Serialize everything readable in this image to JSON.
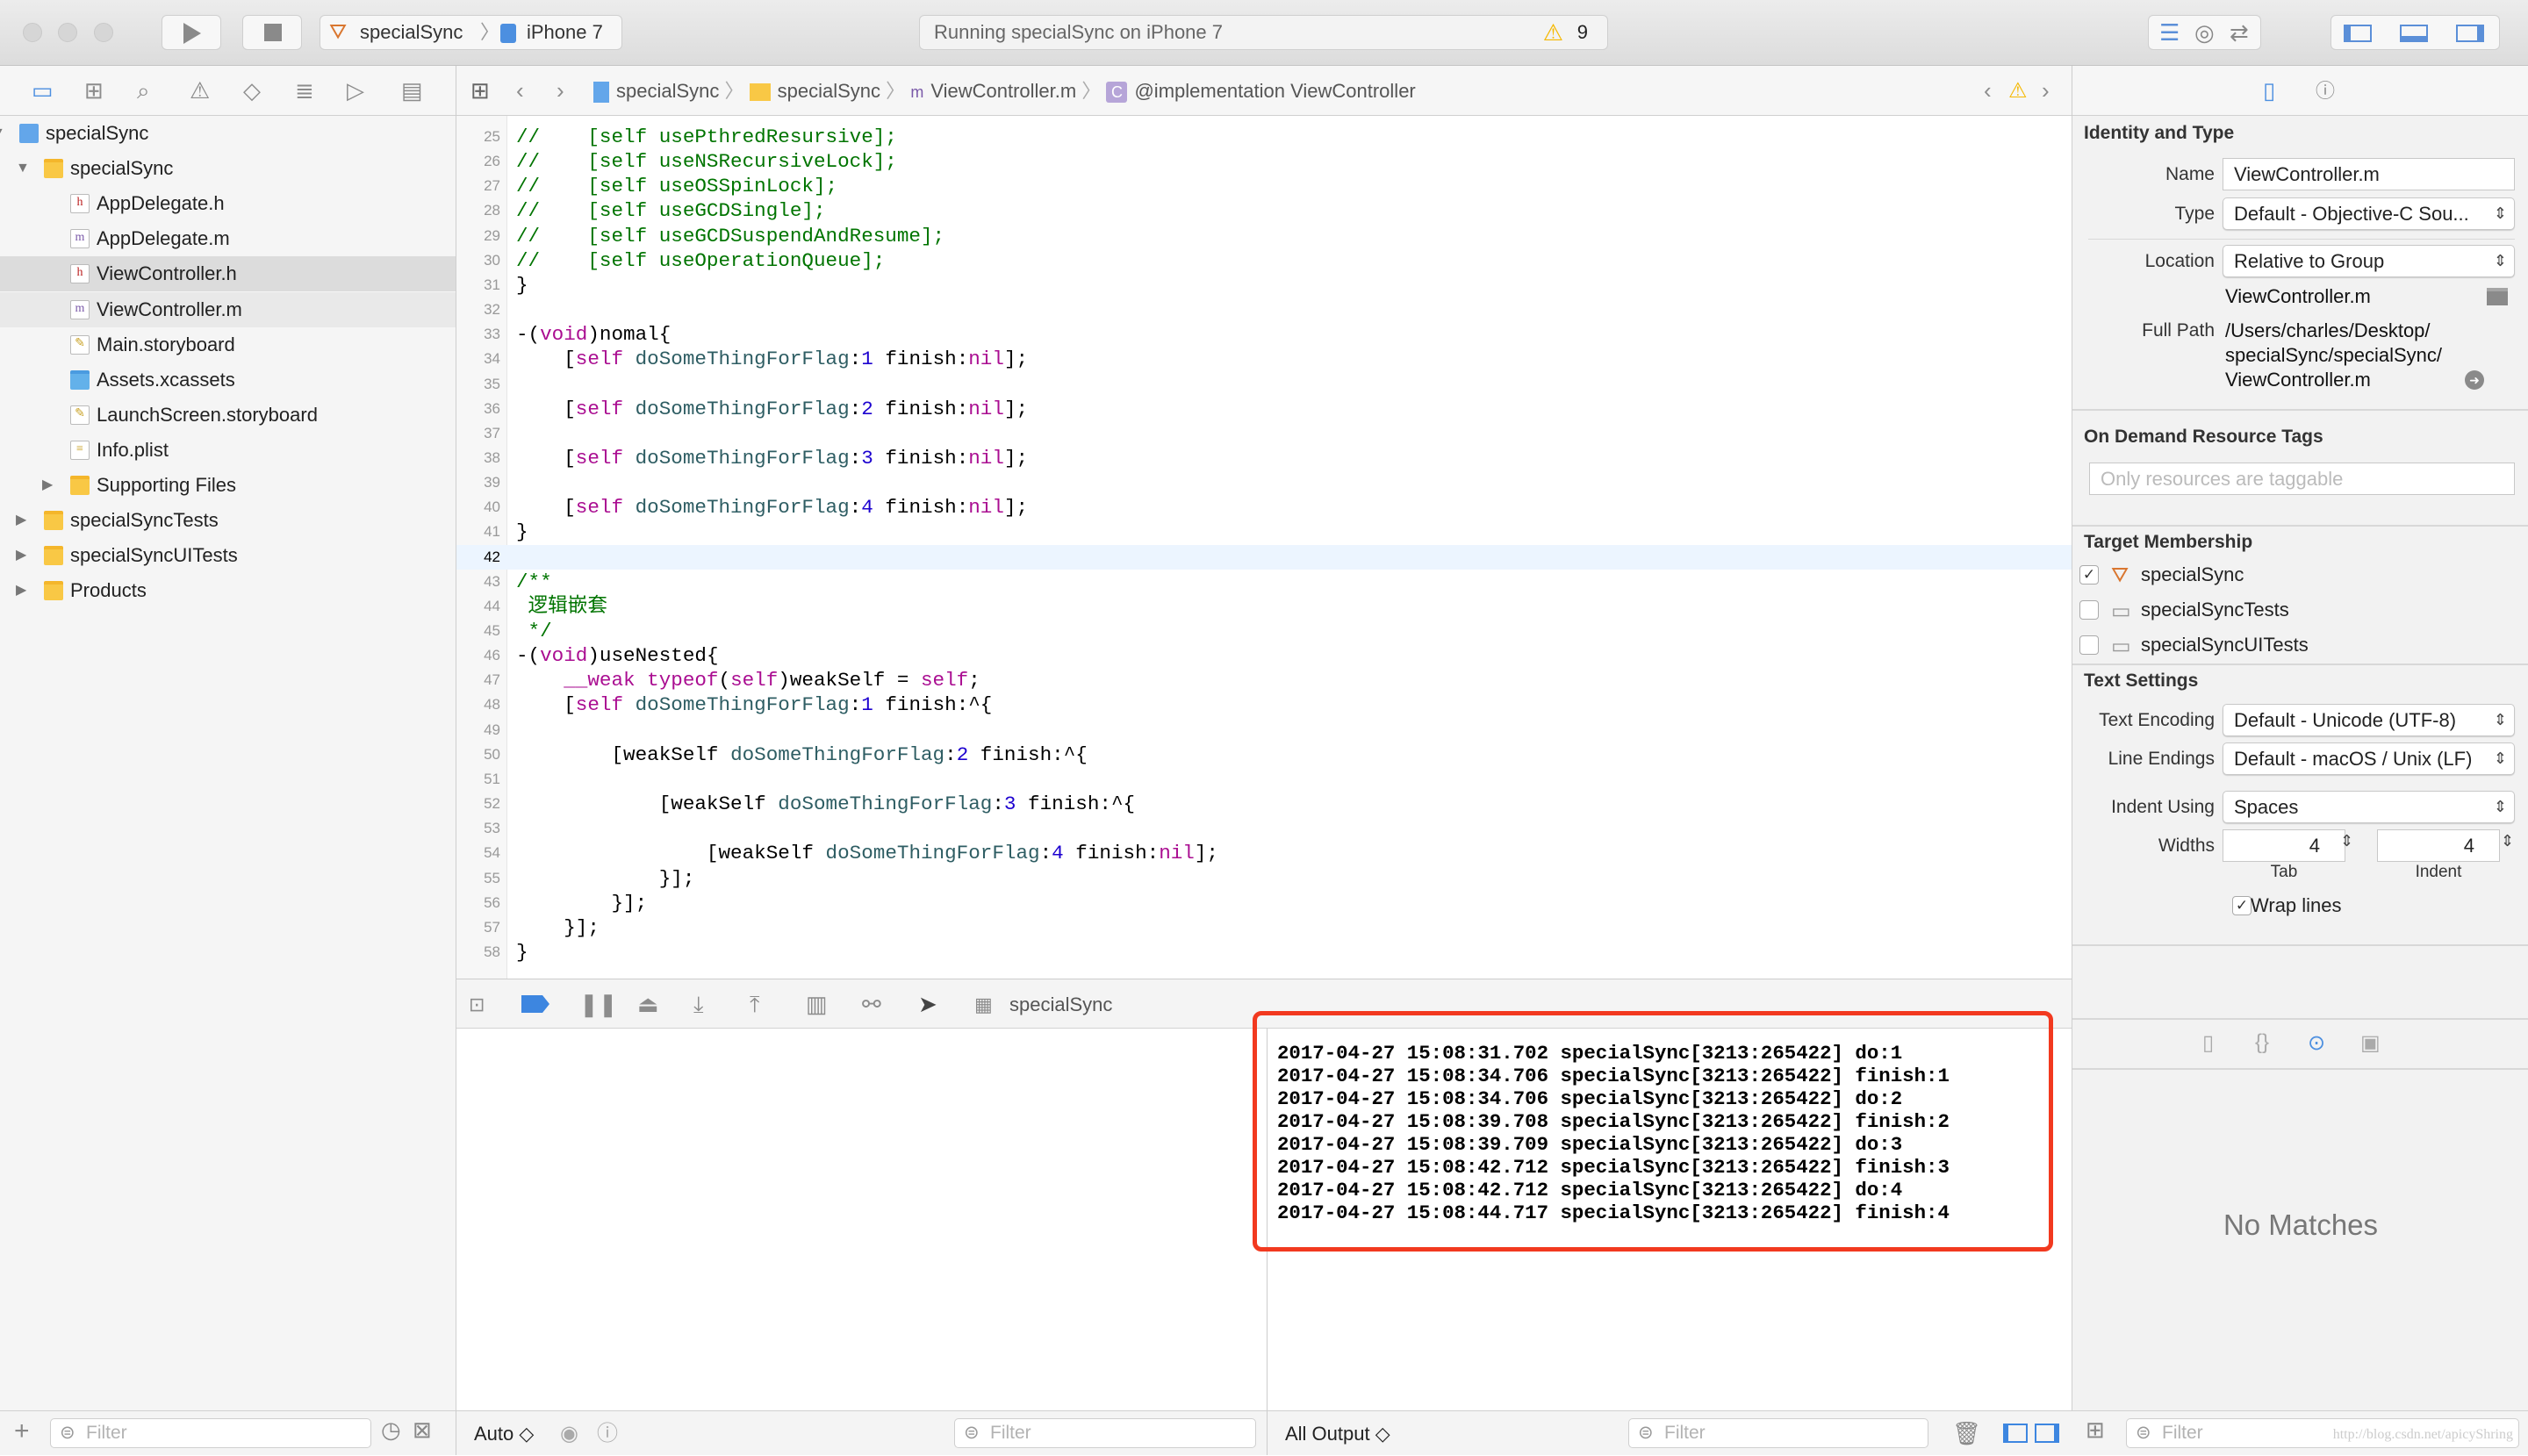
{
  "toolbar": {
    "scheme": "specialSync",
    "device": "iPhone 7",
    "activity": "Running specialSync on iPhone 7",
    "warning_count": "9"
  },
  "jumpbar": {
    "crumbs": [
      "specialSync",
      "specialSync",
      "ViewController.m",
      "@implementation ViewController"
    ]
  },
  "navigator": {
    "items": [
      {
        "label": "specialSync",
        "kind": "project",
        "level": 0,
        "disclosure": "open"
      },
      {
        "label": "specialSync",
        "kind": "folder",
        "level": 1,
        "disclosure": "open"
      },
      {
        "label": "AppDelegate.h",
        "kind": "h",
        "level": 2
      },
      {
        "label": "AppDelegate.m",
        "kind": "m",
        "level": 2
      },
      {
        "label": "ViewController.h",
        "kind": "h",
        "level": 2,
        "selected": true
      },
      {
        "label": "ViewController.m",
        "kind": "m",
        "level": 2,
        "secondary": true
      },
      {
        "label": "Main.storyboard",
        "kind": "sb",
        "level": 2
      },
      {
        "label": "Assets.xcassets",
        "kind": "assets",
        "level": 2
      },
      {
        "label": "LaunchScreen.storyboard",
        "kind": "sb",
        "level": 2
      },
      {
        "label": "Info.plist",
        "kind": "plist",
        "level": 2
      },
      {
        "label": "Supporting Files",
        "kind": "folder",
        "level": 2,
        "disclosure": "closed"
      },
      {
        "label": "specialSyncTests",
        "kind": "folder",
        "level": 1,
        "disclosure": "closed"
      },
      {
        "label": "specialSyncUITests",
        "kind": "folder",
        "level": 1,
        "disclosure": "closed"
      },
      {
        "label": "Products",
        "kind": "folder",
        "level": 1,
        "disclosure": "closed"
      }
    ],
    "filter_placeholder": "Filter"
  },
  "editor": {
    "current_line": 42,
    "lines": [
      {
        "n": 25,
        "t": [
          [
            "c",
            "//    [self usePthredResursive];"
          ]
        ]
      },
      {
        "n": 26,
        "t": [
          [
            "c",
            "//    [self useNSRecursiveLock];"
          ]
        ]
      },
      {
        "n": 27,
        "t": [
          [
            "c",
            "//    [self useOSSpinLock];"
          ]
        ]
      },
      {
        "n": 28,
        "t": [
          [
            "c",
            "//    [self useGCDSingle];"
          ]
        ]
      },
      {
        "n": 29,
        "t": [
          [
            "c",
            "//    [self useGCDSuspendAndResume];"
          ]
        ]
      },
      {
        "n": 30,
        "t": [
          [
            "c",
            "//    [self useOperationQueue];"
          ]
        ]
      },
      {
        "n": 31,
        "t": [
          [
            "p",
            "}"
          ]
        ]
      },
      {
        "n": 32,
        "t": []
      },
      {
        "n": 33,
        "t": [
          [
            "p",
            "-("
          ],
          [
            "k",
            "void"
          ],
          [
            "p",
            ")nomal{"
          ]
        ]
      },
      {
        "n": 34,
        "t": [
          [
            "p",
            "    ["
          ],
          [
            "k",
            "self"
          ],
          [
            "p",
            " "
          ],
          [
            "m",
            "doSomeThingForFlag"
          ],
          [
            "p",
            ":"
          ],
          [
            "n",
            "1"
          ],
          [
            "p",
            " finish:"
          ],
          [
            "k",
            "nil"
          ],
          [
            "p",
            "];"
          ]
        ]
      },
      {
        "n": 35,
        "t": []
      },
      {
        "n": 36,
        "t": [
          [
            "p",
            "    ["
          ],
          [
            "k",
            "self"
          ],
          [
            "p",
            " "
          ],
          [
            "m",
            "doSomeThingForFlag"
          ],
          [
            "p",
            ":"
          ],
          [
            "n",
            "2"
          ],
          [
            "p",
            " finish:"
          ],
          [
            "k",
            "nil"
          ],
          [
            "p",
            "];"
          ]
        ]
      },
      {
        "n": 37,
        "t": []
      },
      {
        "n": 38,
        "t": [
          [
            "p",
            "    ["
          ],
          [
            "k",
            "self"
          ],
          [
            "p",
            " "
          ],
          [
            "m",
            "doSomeThingForFlag"
          ],
          [
            "p",
            ":"
          ],
          [
            "n",
            "3"
          ],
          [
            "p",
            " finish:"
          ],
          [
            "k",
            "nil"
          ],
          [
            "p",
            "];"
          ]
        ]
      },
      {
        "n": 39,
        "t": []
      },
      {
        "n": 40,
        "t": [
          [
            "p",
            "    ["
          ],
          [
            "k",
            "self"
          ],
          [
            "p",
            " "
          ],
          [
            "m",
            "doSomeThingForFlag"
          ],
          [
            "p",
            ":"
          ],
          [
            "n",
            "4"
          ],
          [
            "p",
            " finish:"
          ],
          [
            "k",
            "nil"
          ],
          [
            "p",
            "];"
          ]
        ]
      },
      {
        "n": 41,
        "t": [
          [
            "p",
            "}"
          ]
        ]
      },
      {
        "n": 42,
        "t": []
      },
      {
        "n": 43,
        "t": [
          [
            "c",
            "/**"
          ]
        ]
      },
      {
        "n": 44,
        "t": [
          [
            "c",
            " 逻辑嵌套"
          ]
        ]
      },
      {
        "n": 45,
        "t": [
          [
            "c",
            " */"
          ]
        ]
      },
      {
        "n": 46,
        "t": [
          [
            "p",
            "-("
          ],
          [
            "k",
            "void"
          ],
          [
            "p",
            ")useNested{"
          ]
        ]
      },
      {
        "n": 47,
        "t": [
          [
            "p",
            "    "
          ],
          [
            "k",
            "__weak typeof"
          ],
          [
            "p",
            "("
          ],
          [
            "k",
            "self"
          ],
          [
            "p",
            ")weakSelf = "
          ],
          [
            "k",
            "self"
          ],
          [
            "p",
            ";"
          ]
        ]
      },
      {
        "n": 48,
        "t": [
          [
            "p",
            "    ["
          ],
          [
            "k",
            "self"
          ],
          [
            "p",
            " "
          ],
          [
            "m",
            "doSomeThingForFlag"
          ],
          [
            "p",
            ":"
          ],
          [
            "n",
            "1"
          ],
          [
            "p",
            " finish:^{"
          ]
        ]
      },
      {
        "n": 49,
        "t": []
      },
      {
        "n": 50,
        "t": [
          [
            "p",
            "        [weakSelf "
          ],
          [
            "m",
            "doSomeThingForFlag"
          ],
          [
            "p",
            ":"
          ],
          [
            "n",
            "2"
          ],
          [
            "p",
            " finish:^{"
          ]
        ]
      },
      {
        "n": 51,
        "t": []
      },
      {
        "n": 52,
        "t": [
          [
            "p",
            "            [weakSelf "
          ],
          [
            "m",
            "doSomeThingForFlag"
          ],
          [
            "p",
            ":"
          ],
          [
            "n",
            "3"
          ],
          [
            "p",
            " finish:^{"
          ]
        ]
      },
      {
        "n": 53,
        "t": []
      },
      {
        "n": 54,
        "t": [
          [
            "p",
            "                [weakSelf "
          ],
          [
            "m",
            "doSomeThingForFlag"
          ],
          [
            "p",
            ":"
          ],
          [
            "n",
            "4"
          ],
          [
            "p",
            " finish:"
          ],
          [
            "k",
            "nil"
          ],
          [
            "p",
            "];"
          ]
        ]
      },
      {
        "n": 55,
        "t": [
          [
            "p",
            "            }];"
          ]
        ]
      },
      {
        "n": 56,
        "t": [
          [
            "p",
            "        }];"
          ]
        ]
      },
      {
        "n": 57,
        "t": [
          [
            "p",
            "    }];"
          ]
        ]
      },
      {
        "n": 58,
        "t": [
          [
            "p",
            "}"
          ]
        ]
      }
    ]
  },
  "debugbar": {
    "process": "specialSync"
  },
  "variables": {
    "scope": "Auto ◇",
    "filter_placeholder": "Filter"
  },
  "console": {
    "output": "All Output ◇",
    "filter_placeholder": "Filter",
    "lines": [
      "2017-04-27 15:08:31.702 specialSync[3213:265422] do:1",
      "2017-04-27 15:08:34.706 specialSync[3213:265422] finish:1",
      "2017-04-27 15:08:34.706 specialSync[3213:265422] do:2",
      "2017-04-27 15:08:39.708 specialSync[3213:265422] finish:2",
      "2017-04-27 15:08:39.709 specialSync[3213:265422] do:3",
      "2017-04-27 15:08:42.712 specialSync[3213:265422] finish:3",
      "2017-04-27 15:08:42.712 specialSync[3213:265422] do:4",
      "2017-04-27 15:08:44.717 specialSync[3213:265422] finish:4"
    ],
    "highlight_color": "#f2391f"
  },
  "inspector": {
    "identity_header": "Identity and Type",
    "name_label": "Name",
    "name_value": "ViewController.m",
    "type_label": "Type",
    "type_value": "Default - Objective-C Sou...",
    "location_label": "Location",
    "location_value": "Relative to Group",
    "location_file": "ViewController.m",
    "fullpath_label": "Full Path",
    "fullpath_lines": [
      "/Users/charles/Desktop/",
      "specialSync/specialSync/",
      "ViewController.m"
    ],
    "odr_header": "On Demand Resource Tags",
    "odr_placeholder": "Only resources are taggable",
    "target_header": "Target Membership",
    "targets": [
      {
        "label": "specialSync",
        "checked": true
      },
      {
        "label": "specialSyncTests",
        "checked": false
      },
      {
        "label": "specialSyncUITests",
        "checked": false
      }
    ],
    "text_header": "Text Settings",
    "encoding_label": "Text Encoding",
    "encoding_value": "Default - Unicode (UTF-8)",
    "endings_label": "Line Endings",
    "endings_value": "Default - macOS / Unix (LF)",
    "indent_label": "Indent Using",
    "indent_value": "Spaces",
    "widths_label": "Widths",
    "tab_width": "4",
    "indent_width": "4",
    "tab_label": "Tab",
    "indent_sub_label": "Indent",
    "wrap_label": "Wrap lines",
    "wrap_checked": true,
    "library_empty": "No Matches",
    "filter_placeholder": "Filter",
    "watermark": "http://blog.csdn.net/apicyShring"
  }
}
